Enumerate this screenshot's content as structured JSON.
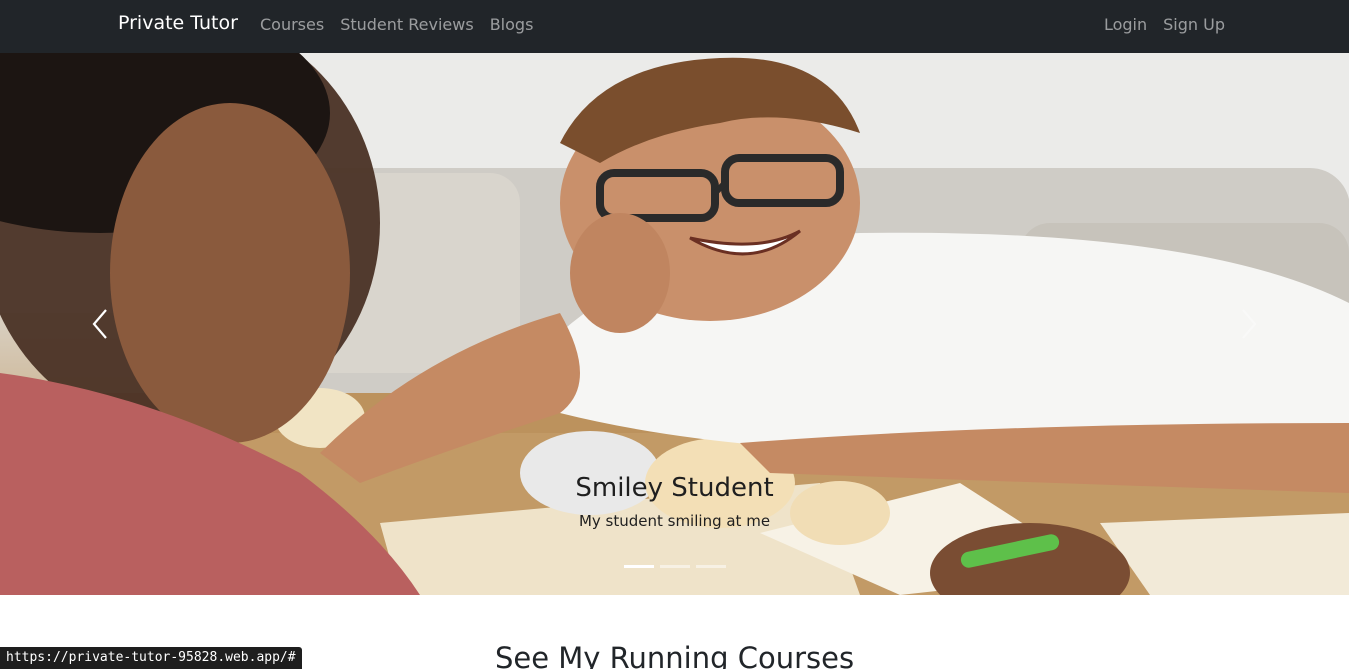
{
  "navbar": {
    "brand": "Private Tutor",
    "left_links": [
      "Courses",
      "Student Reviews",
      "Blogs"
    ],
    "right_links": [
      "Login",
      "Sign Up"
    ]
  },
  "carousel": {
    "caption_title": "Smiley Student",
    "caption_text": "My student smiling at me",
    "prev_icon": "chevron-left-icon",
    "next_icon": "chevron-right-icon",
    "slide_count": 3,
    "active_slide": 1
  },
  "main": {
    "section_title": "See My Running Courses"
  },
  "status_bar": {
    "url": "https://private-tutor-95828.web.app/#"
  }
}
